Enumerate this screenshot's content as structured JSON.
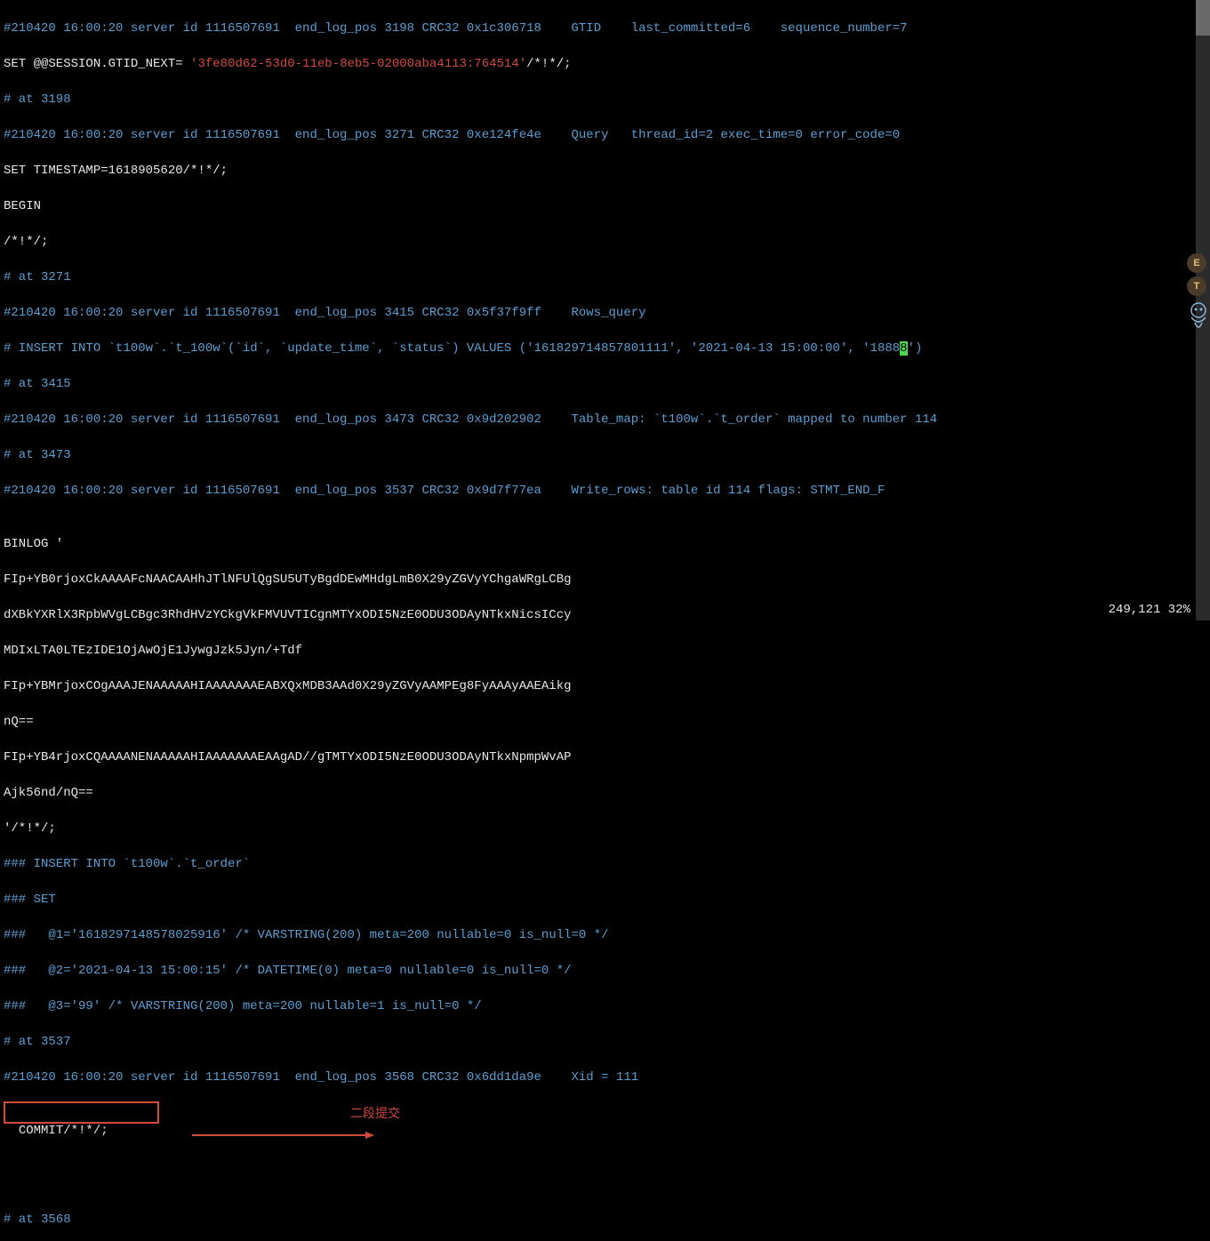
{
  "lines": {
    "l1a": "#210420 16:00:20 server id 1116507691  end_log_pos 3198 CRC32 0x1c306718    GTID    last_committed=6    sequence_number=7",
    "l2a": "SET @@SESSION.GTID_NEXT= ",
    "l2b": "'3fe80d62-53d0-11eb-8eb5-02000aba4113:764514'",
    "l2c": "/*!*/;",
    "l3": "# at 3198",
    "l4": "#210420 16:00:20 server id 1116507691  end_log_pos 3271 CRC32 0xe124fe4e    Query   thread_id=2 exec_time=0 error_code=0",
    "l5": "SET TIMESTAMP=1618905620/*!*/;",
    "l6": "BEGIN",
    "l7": "/*!*/;",
    "l8": "# at 3271",
    "l9": "#210420 16:00:20 server id 1116507691  end_log_pos 3415 CRC32 0x5f37f9ff    Rows_query",
    "l10a": "# INSERT INTO `t100w`.`t_100w`(`id`, `update_time`, `status`) VALUES ('161829714857801111', '2021-04-13 15:00:00', '1888",
    "l10b": "8",
    "l10c": "')",
    "l11": "# at 3415",
    "l12": "#210420 16:00:20 server id 1116507691  end_log_pos 3473 CRC32 0x9d202902    Table_map: `t100w`.`t_order` mapped to number 114",
    "l13": "# at 3473",
    "l14": "#210420 16:00:20 server id 1116507691  end_log_pos 3537 CRC32 0x9d7f77ea    Write_rows: table id 114 flags: STMT_END_F",
    "l15": "",
    "l16": "BINLOG '",
    "l17": "FIp+YB0rjoxCkAAAAFcNAACAAHhJTlNFUlQgSU5UTyBgdDEwMHdgLmB0X29yZGVyYChgaWRgLCBg",
    "l18": "dXBkYXRlX3RpbWVgLCBgc3RhdHVzYCkgVkFMVUVTICgnMTYxODI5NzE0ODU3ODAyNTkxNicsICcy",
    "l19": "MDIxLTA0LTEzIDE1OjAwOjE1JywgJzk5Jyn/+Tdf",
    "l20": "FIp+YBMrjoxCOgAAAJENAAAAAHIAAAAAAAEABXQxMDB3AAd0X29yZGVyAAMPEg8FyAAAyAAEAikg",
    "l21": "nQ==",
    "l22": "FIp+YB4rjoxCQAAAANENAAAAAHIAAAAAAAEAAgAD//gTMTYxODI5NzE0ODU3ODAyNTkxNpmpWvAP",
    "l23": "Ajk56nd/nQ==",
    "l24": "'/*!*/;",
    "l25": "### INSERT INTO `t100w`.`t_order`",
    "l26": "### SET",
    "l27": "###   @1='1618297148578025916' /* VARSTRING(200) meta=200 nullable=0 is_null=0 */",
    "l28": "###   @2='2021-04-13 15:00:15' /* DATETIME(0) meta=0 nullable=0 is_null=0 */",
    "l29": "###   @3='99' /* VARSTRING(200) meta=200 nullable=1 is_null=0 */",
    "l30": "# at 3537",
    "l31": "#210420 16:00:20 server id 1116507691  end_log_pos 3568 CRC32 0x6dd1da9e    Xid = 111",
    "l32": "COMMIT/*!*/;",
    "l33": "# at 3568"
  },
  "annotation": "二段提交",
  "status": {
    "pos": "249,121",
    "pct": "32%"
  },
  "badges": {
    "e": "E",
    "t": "T"
  }
}
